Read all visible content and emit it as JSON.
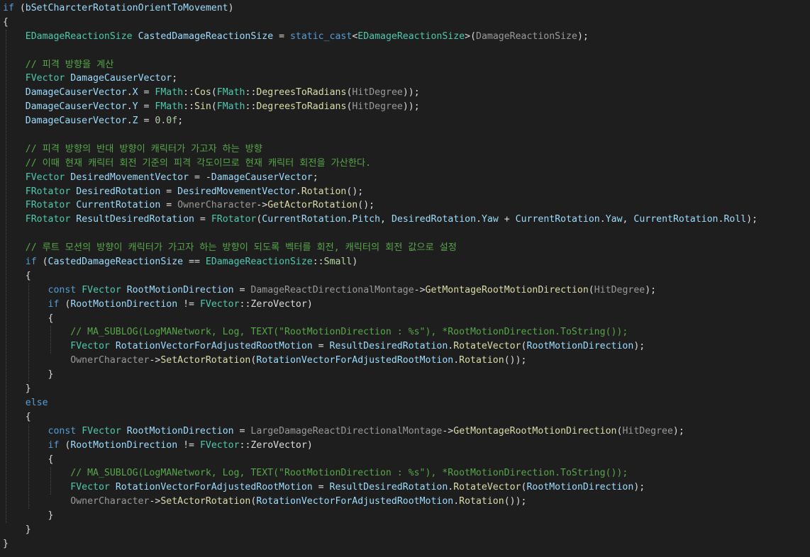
{
  "editor": {
    "colors": {
      "background": "#1e1e1e",
      "keyword": "#569cd6",
      "type": "#4ec9b0",
      "variable": "#9cdcfe",
      "function": "#dcdcaa",
      "number": "#b5cea8",
      "string": "#d69d85",
      "comment": "#57a64a",
      "parameter": "#9a9a9a",
      "plain": "#dcdcdc",
      "enum_member": "#b8d7a3"
    },
    "lines": [
      [
        [
          "kw",
          "if"
        ],
        [
          "plain",
          " ("
        ],
        [
          "var",
          "bSetCharcterRotationOrientToMovement"
        ],
        [
          "plain",
          ")"
        ]
      ],
      [
        [
          "plain",
          "{"
        ]
      ],
      [
        [
          "plain",
          "    "
        ],
        [
          "type",
          "EDamageReactionSize"
        ],
        [
          "plain",
          " "
        ],
        [
          "var",
          "CastedDamageReactionSize"
        ],
        [
          "plain",
          " = "
        ],
        [
          "kw",
          "static_cast"
        ],
        [
          "plain",
          "<"
        ],
        [
          "type",
          "EDamageReactionSize"
        ],
        [
          "plain",
          ">("
        ],
        [
          "param",
          "DamageReactionSize"
        ],
        [
          "plain",
          ");"
        ]
      ],
      [
        [
          "plain",
          ""
        ]
      ],
      [
        [
          "plain",
          "    "
        ],
        [
          "cm",
          "// 피격 방향을 계산"
        ]
      ],
      [
        [
          "plain",
          "    "
        ],
        [
          "type",
          "FVector"
        ],
        [
          "plain",
          " "
        ],
        [
          "var",
          "DamageCauserVector"
        ],
        [
          "plain",
          ";"
        ]
      ],
      [
        [
          "plain",
          "    "
        ],
        [
          "var",
          "DamageCauserVector"
        ],
        [
          "plain",
          "."
        ],
        [
          "var",
          "X"
        ],
        [
          "plain",
          " = "
        ],
        [
          "type",
          "FMath"
        ],
        [
          "plain",
          "::"
        ],
        [
          "fn",
          "Cos"
        ],
        [
          "plain",
          "("
        ],
        [
          "type",
          "FMath"
        ],
        [
          "plain",
          "::"
        ],
        [
          "fn",
          "DegreesToRadians"
        ],
        [
          "plain",
          "("
        ],
        [
          "param",
          "HitDegree"
        ],
        [
          "plain",
          "));"
        ]
      ],
      [
        [
          "plain",
          "    "
        ],
        [
          "var",
          "DamageCauserVector"
        ],
        [
          "plain",
          "."
        ],
        [
          "var",
          "Y"
        ],
        [
          "plain",
          " = "
        ],
        [
          "type",
          "FMath"
        ],
        [
          "plain",
          "::"
        ],
        [
          "fn",
          "Sin"
        ],
        [
          "plain",
          "("
        ],
        [
          "type",
          "FMath"
        ],
        [
          "plain",
          "::"
        ],
        [
          "fn",
          "DegreesToRadians"
        ],
        [
          "plain",
          "("
        ],
        [
          "param",
          "HitDegree"
        ],
        [
          "plain",
          "));"
        ]
      ],
      [
        [
          "plain",
          "    "
        ],
        [
          "var",
          "DamageCauserVector"
        ],
        [
          "plain",
          "."
        ],
        [
          "var",
          "Z"
        ],
        [
          "plain",
          " = "
        ],
        [
          "num",
          "0.0f"
        ],
        [
          "plain",
          ";"
        ]
      ],
      [
        [
          "plain",
          ""
        ]
      ],
      [
        [
          "plain",
          "    "
        ],
        [
          "cm",
          "// 피격 방향의 반대 방향이 캐릭터가 가고자 하는 방향"
        ]
      ],
      [
        [
          "plain",
          "    "
        ],
        [
          "cm",
          "// 이때 현재 캐릭터 회전 기준의 피격 각도이므로 현재 캐릭터 회전을 가산한다."
        ]
      ],
      [
        [
          "plain",
          "    "
        ],
        [
          "type",
          "FVector"
        ],
        [
          "plain",
          " "
        ],
        [
          "var",
          "DesiredMovementVector"
        ],
        [
          "plain",
          " = -"
        ],
        [
          "var",
          "DamageCauserVector"
        ],
        [
          "plain",
          ";"
        ]
      ],
      [
        [
          "plain",
          "    "
        ],
        [
          "type",
          "FRotator"
        ],
        [
          "plain",
          " "
        ],
        [
          "var",
          "DesiredRotation"
        ],
        [
          "plain",
          " = "
        ],
        [
          "var",
          "DesiredMovementVector"
        ],
        [
          "plain",
          "."
        ],
        [
          "fn",
          "Rotation"
        ],
        [
          "plain",
          "();"
        ]
      ],
      [
        [
          "plain",
          "    "
        ],
        [
          "type",
          "FRotator"
        ],
        [
          "plain",
          " "
        ],
        [
          "var",
          "CurrentRotation"
        ],
        [
          "plain",
          " = "
        ],
        [
          "param",
          "OwnerCharacter"
        ],
        [
          "plain",
          "->"
        ],
        [
          "fn",
          "GetActorRotation"
        ],
        [
          "plain",
          "();"
        ]
      ],
      [
        [
          "plain",
          "    "
        ],
        [
          "type",
          "FRotator"
        ],
        [
          "plain",
          " "
        ],
        [
          "var",
          "ResultDesiredRotation"
        ],
        [
          "plain",
          " = "
        ],
        [
          "type",
          "FRotator"
        ],
        [
          "plain",
          "("
        ],
        [
          "var",
          "CurrentRotation"
        ],
        [
          "plain",
          "."
        ],
        [
          "var",
          "Pitch"
        ],
        [
          "plain",
          ", "
        ],
        [
          "var",
          "DesiredRotation"
        ],
        [
          "plain",
          "."
        ],
        [
          "var",
          "Yaw"
        ],
        [
          "plain",
          " + "
        ],
        [
          "var",
          "CurrentRotation"
        ],
        [
          "plain",
          "."
        ],
        [
          "var",
          "Yaw"
        ],
        [
          "plain",
          ", "
        ],
        [
          "var",
          "CurrentRotation"
        ],
        [
          "plain",
          "."
        ],
        [
          "var",
          "Roll"
        ],
        [
          "plain",
          ");"
        ]
      ],
      [
        [
          "plain",
          ""
        ]
      ],
      [
        [
          "plain",
          "    "
        ],
        [
          "cm",
          "// 루트 모션의 방향이 캐릭터가 가고자 하는 방향이 되도록 벡터를 회전, 캐릭터의 회전 값으로 설정"
        ]
      ],
      [
        [
          "plain",
          "    "
        ],
        [
          "kw",
          "if"
        ],
        [
          "plain",
          " ("
        ],
        [
          "var",
          "CastedDamageReactionSize"
        ],
        [
          "plain",
          " == "
        ],
        [
          "type",
          "EDamageReactionSize"
        ],
        [
          "plain",
          "::"
        ],
        [
          "enum",
          "Small"
        ],
        [
          "plain",
          ")"
        ]
      ],
      [
        [
          "plain",
          "    {"
        ]
      ],
      [
        [
          "plain",
          "        "
        ],
        [
          "kw",
          "const"
        ],
        [
          "plain",
          " "
        ],
        [
          "type",
          "FVector"
        ],
        [
          "plain",
          " "
        ],
        [
          "var",
          "RootMotionDirection"
        ],
        [
          "plain",
          " = "
        ],
        [
          "param",
          "DamageReactDirectionalMontage"
        ],
        [
          "plain",
          "->"
        ],
        [
          "fn",
          "GetMontageRootMotionDirection"
        ],
        [
          "plain",
          "("
        ],
        [
          "param",
          "HitDegree"
        ],
        [
          "plain",
          ");"
        ]
      ],
      [
        [
          "plain",
          "        "
        ],
        [
          "kw",
          "if"
        ],
        [
          "plain",
          " ("
        ],
        [
          "var",
          "RootMotionDirection"
        ],
        [
          "plain",
          " != "
        ],
        [
          "type",
          "FVector"
        ],
        [
          "plain",
          "::"
        ],
        [
          "plain",
          "ZeroVector"
        ],
        [
          "plain",
          ")"
        ]
      ],
      [
        [
          "plain",
          "        {"
        ]
      ],
      [
        [
          "plain",
          "            "
        ],
        [
          "cm",
          "// MA_SUBLOG(LogMANetwork, Log, TEXT(\"RootMotionDirection : %s\"), *RootMotionDirection.ToString());"
        ]
      ],
      [
        [
          "plain",
          "            "
        ],
        [
          "type",
          "FVector"
        ],
        [
          "plain",
          " "
        ],
        [
          "var",
          "RotationVectorForAdjustedRootMotion"
        ],
        [
          "plain",
          " = "
        ],
        [
          "var",
          "ResultDesiredRotation"
        ],
        [
          "plain",
          "."
        ],
        [
          "fn",
          "RotateVector"
        ],
        [
          "plain",
          "("
        ],
        [
          "var",
          "RootMotionDirection"
        ],
        [
          "plain",
          ");"
        ]
      ],
      [
        [
          "plain",
          "            "
        ],
        [
          "param",
          "OwnerCharacter"
        ],
        [
          "plain",
          "->"
        ],
        [
          "fn",
          "SetActorRotation"
        ],
        [
          "plain",
          "("
        ],
        [
          "var",
          "RotationVectorForAdjustedRootMotion"
        ],
        [
          "plain",
          "."
        ],
        [
          "fn",
          "Rotation"
        ],
        [
          "plain",
          "());"
        ]
      ],
      [
        [
          "plain",
          "        }"
        ]
      ],
      [
        [
          "plain",
          "    }"
        ]
      ],
      [
        [
          "plain",
          "    "
        ],
        [
          "kw",
          "else"
        ]
      ],
      [
        [
          "plain",
          "    {"
        ]
      ],
      [
        [
          "plain",
          "        "
        ],
        [
          "kw",
          "const"
        ],
        [
          "plain",
          " "
        ],
        [
          "type",
          "FVector"
        ],
        [
          "plain",
          " "
        ],
        [
          "var",
          "RootMotionDirection"
        ],
        [
          "plain",
          " = "
        ],
        [
          "param",
          "LargeDamageReactDirectionalMontage"
        ],
        [
          "plain",
          "->"
        ],
        [
          "fn",
          "GetMontageRootMotionDirection"
        ],
        [
          "plain",
          "("
        ],
        [
          "param",
          "HitDegree"
        ],
        [
          "plain",
          ");"
        ]
      ],
      [
        [
          "plain",
          "        "
        ],
        [
          "kw",
          "if"
        ],
        [
          "plain",
          " ("
        ],
        [
          "var",
          "RootMotionDirection"
        ],
        [
          "plain",
          " != "
        ],
        [
          "type",
          "FVector"
        ],
        [
          "plain",
          "::"
        ],
        [
          "plain",
          "ZeroVector"
        ],
        [
          "plain",
          ")"
        ]
      ],
      [
        [
          "plain",
          "        {"
        ]
      ],
      [
        [
          "plain",
          "            "
        ],
        [
          "cm",
          "// MA_SUBLOG(LogMANetwork, Log, TEXT(\"RootMotionDirection : %s\"), *RootMotionDirection.ToString());"
        ]
      ],
      [
        [
          "plain",
          "            "
        ],
        [
          "type",
          "FVector"
        ],
        [
          "plain",
          " "
        ],
        [
          "var",
          "RotationVectorForAdjustedRootMotion"
        ],
        [
          "plain",
          " = "
        ],
        [
          "var",
          "ResultDesiredRotation"
        ],
        [
          "plain",
          "."
        ],
        [
          "fn",
          "RotateVector"
        ],
        [
          "plain",
          "("
        ],
        [
          "var",
          "RootMotionDirection"
        ],
        [
          "plain",
          ");"
        ]
      ],
      [
        [
          "plain",
          "            "
        ],
        [
          "param",
          "OwnerCharacter"
        ],
        [
          "plain",
          "->"
        ],
        [
          "fn",
          "SetActorRotation"
        ],
        [
          "plain",
          "("
        ],
        [
          "var",
          "RotationVectorForAdjustedRootMotion"
        ],
        [
          "plain",
          "."
        ],
        [
          "fn",
          "Rotation"
        ],
        [
          "plain",
          "());"
        ]
      ],
      [
        [
          "plain",
          "        }"
        ]
      ],
      [
        [
          "plain",
          "    }"
        ]
      ],
      [
        [
          "plain",
          "}"
        ]
      ]
    ]
  }
}
